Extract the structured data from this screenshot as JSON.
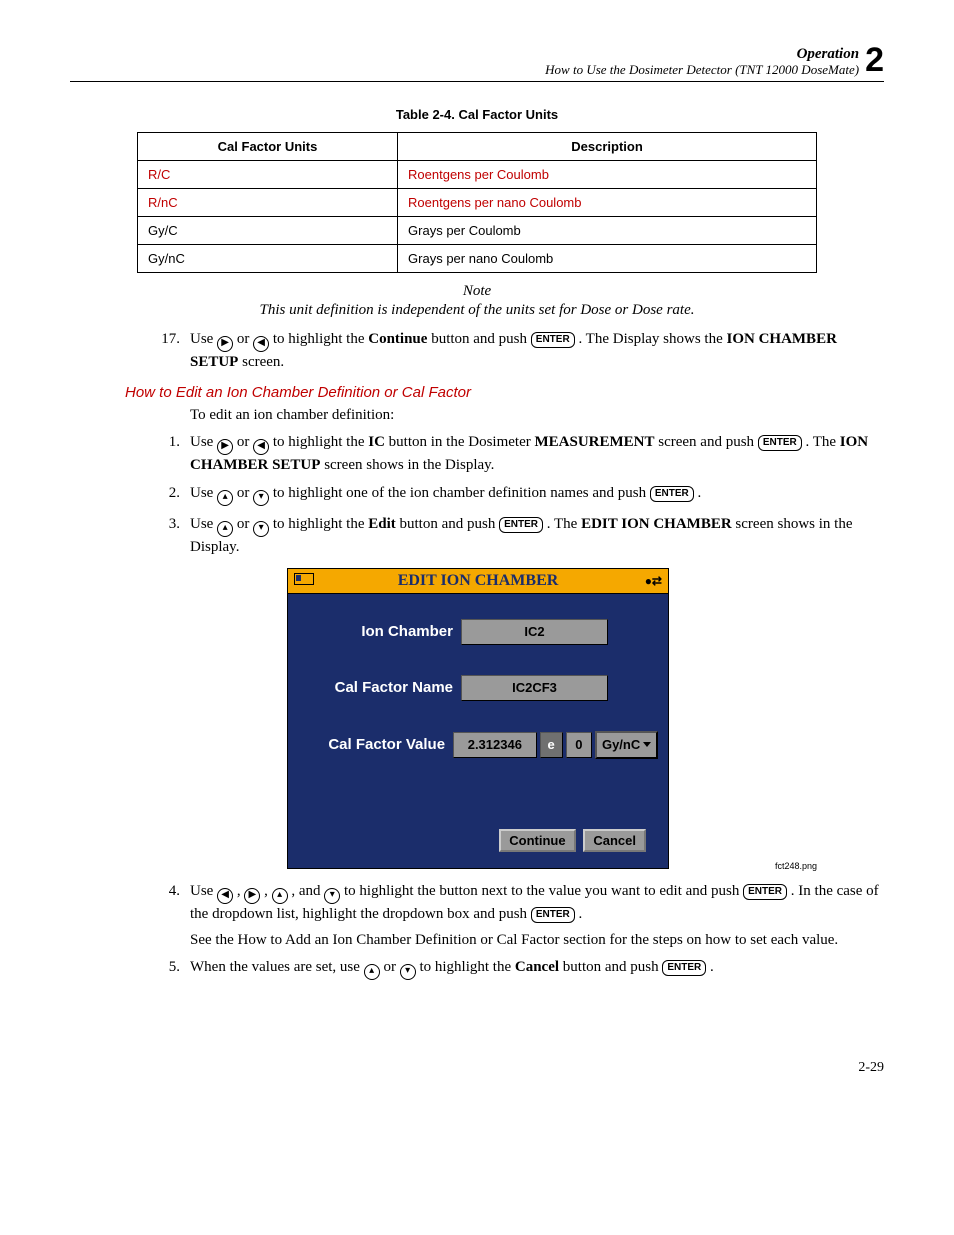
{
  "header": {
    "chapter_title": "Operation",
    "subtitle": "How to Use the Dosimeter Detector (TNT 12000 DoseMate)",
    "chapter_num": "2"
  },
  "table": {
    "caption": "Table 2-4. Cal Factor Units",
    "head1": "Cal Factor Units",
    "head2": "Description",
    "rows": [
      {
        "u": "R/C",
        "d": "Roentgens per Coulomb",
        "hl": true
      },
      {
        "u": "R/nC",
        "d": "Roentgens per nano Coulomb",
        "hl": true
      },
      {
        "u": "Gy/C",
        "d": "Grays per Coulomb",
        "hl": false
      },
      {
        "u": "Gy/nC",
        "d": "Grays per nano Coulomb",
        "hl": false
      }
    ]
  },
  "notes": {
    "label": "Note",
    "text": "This unit definition is independent of the units set for Dose or Dose rate."
  },
  "step17": {
    "num": "17.",
    "p1": "Use ",
    "p2": " or ",
    "p3": " to highlight the ",
    "continue": "Continue",
    "p4": " button and push ",
    "enter": "ENTER",
    "p5": ". The Display shows the ",
    "setup": "ION CHAMBER SETUP",
    "p6": " screen."
  },
  "heading_edit": "How to Edit an Ion Chamber Definition or Cal Factor",
  "intro_edit": "To edit an ion chamber definition:",
  "edit_steps": {
    "s1": {
      "num": "1.",
      "p1": "Use ",
      "p2": " or ",
      "p3": " to highlight the ",
      "ic": "IC",
      "p4": " button in the Dosimeter ",
      "meas": "MEASUREMENT",
      "p5": " screen and push ",
      "enter": "ENTER",
      "p6": ". The ",
      "setup": "ION CHAMBER SETUP",
      "p7": " screen shows in the Display."
    },
    "s2": {
      "num": "2.",
      "p1": "Use ",
      "p2": " or ",
      "p3": " to highlight one of the ion chamber definition names and push ",
      "enter": "ENTER",
      "p4": "."
    },
    "s3": {
      "num": "3.",
      "p1": "Use ",
      "p2": " or ",
      "p3": " to highlight the ",
      "edit": "Edit",
      "p4": " button and push ",
      "enter": "ENTER",
      "p5": ". The ",
      "eic": "EDIT ION CHAMBER",
      "p6": " screen shows in the Display."
    },
    "s4": {
      "num": "4.",
      "p1": "Use ",
      "p2": ", ",
      "p3": ", ",
      "p4": ", and ",
      "p5": " to highlight the button next to the value you want to edit and push ",
      "enter": "ENTER",
      "p6": ". In the case of the dropdown list, highlight the dropdown box and push ",
      "enter2": "ENTER",
      "p7": "."
    },
    "s5": {
      "num": "5.",
      "p1": "When the values are set, use ",
      "p2": " or ",
      "p3": " to highlight the ",
      "cancel": "Cancel",
      "p4": " button and push ",
      "enter": "ENTER",
      "p5": "."
    }
  },
  "see_text": "See the How to Add an Ion Chamber Definition or Cal Factor section for the steps on how to set each value.",
  "screen": {
    "title": "EDIT ION CHAMBER",
    "tb_right": "●⇄",
    "labels": {
      "ion": "Ion Chamber",
      "cfn": "Cal Factor Name",
      "cfv": "Cal Factor Value"
    },
    "values": {
      "ion": "IC2",
      "cfn": "IC2CF3",
      "cfv": "2.312346",
      "e": "e",
      "exp": "0",
      "unit": "Gy/nC"
    },
    "buttons": {
      "continue": "Continue",
      "cancel": "Cancel"
    }
  },
  "img_caption": "fct248.png",
  "page_number": "2-29",
  "chart_data": {
    "type": "table",
    "title": "Cal Factor Units",
    "columns": [
      "Cal Factor Units",
      "Description"
    ],
    "rows": [
      [
        "R/C",
        "Roentgens per Coulomb"
      ],
      [
        "R/nC",
        "Roentgens per nano Coulomb"
      ],
      [
        "Gy/C",
        "Grays per Coulomb"
      ],
      [
        "Gy/nC",
        "Grays per nano Coulomb"
      ]
    ]
  }
}
